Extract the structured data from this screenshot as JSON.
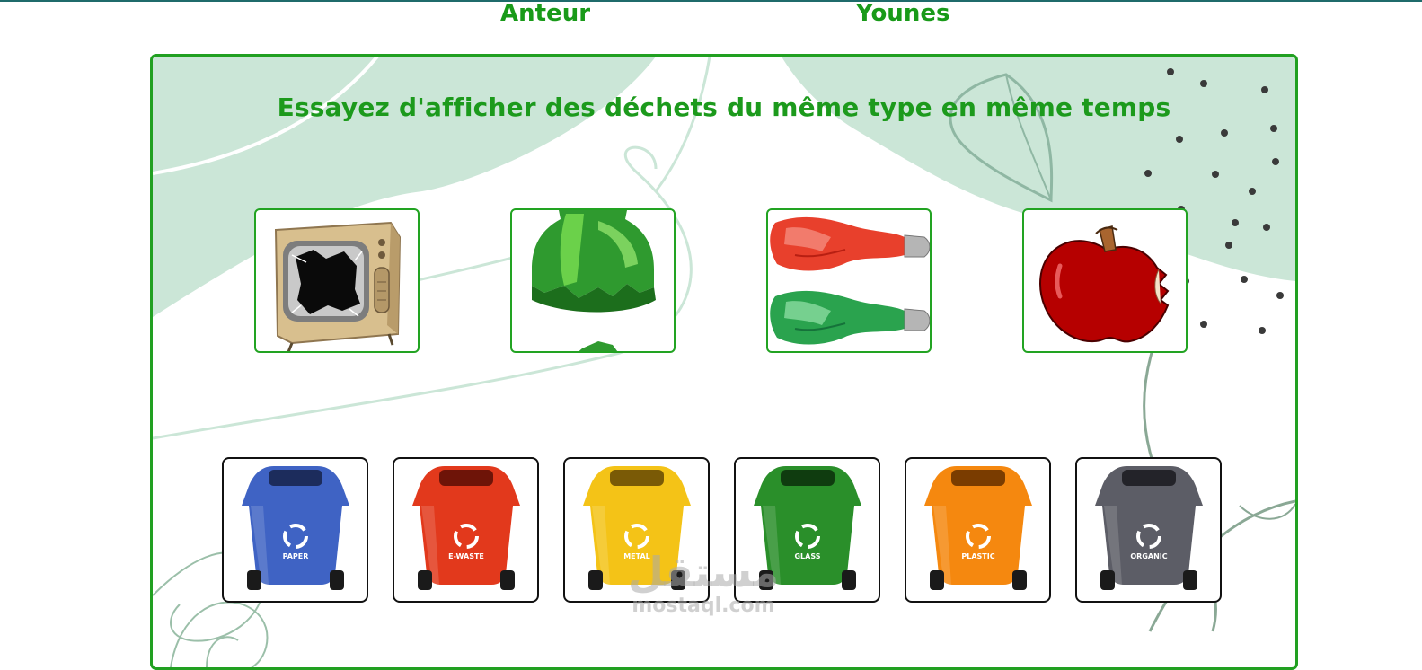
{
  "header": {
    "author_label": "Anteur",
    "author_name": "Younes"
  },
  "game": {
    "instruction": "Essayez d'afficher des déchets du même type en même temps",
    "items": [
      {
        "name": "broken-tv",
        "icon": "broken-tv-image"
      },
      {
        "name": "broken-glass-bottle",
        "icon": "broken-bottle-image"
      },
      {
        "name": "crushed-tubes",
        "icon": "crushed-tubes-image"
      },
      {
        "name": "bitten-apple",
        "icon": "apple-image"
      }
    ],
    "bins": [
      {
        "label": "PAPER",
        "color": "#3f63c4"
      },
      {
        "label": "E-WASTE",
        "color": "#e2391c"
      },
      {
        "label": "METAL",
        "color": "#f4c317"
      },
      {
        "label": "GLASS",
        "color": "#2a8f2a"
      },
      {
        "label": "PLASTIC",
        "color": "#f5880f"
      },
      {
        "label": "ORGANIC",
        "color": "#5c5d66"
      }
    ]
  },
  "colors": {
    "accent_green": "#1c9a1c",
    "frame_border": "#21a021",
    "background_blob": "#cbe6d7"
  },
  "watermark": {
    "arabic": "مستقل",
    "latin": "mostaql.com"
  }
}
